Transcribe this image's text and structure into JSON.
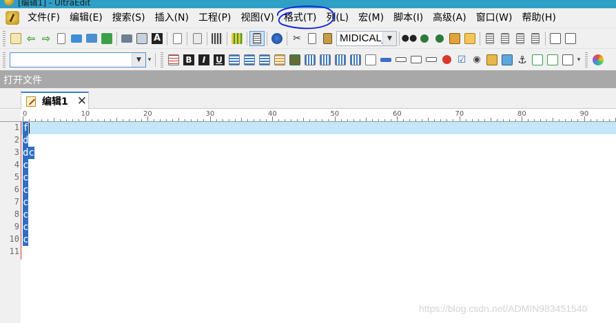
{
  "window": {
    "title": "[编辑1] - UltraEdit"
  },
  "menu": {
    "items": [
      "文件(F)",
      "编辑(E)",
      "搜索(S)",
      "插入(N)",
      "工程(P)",
      "视图(V)",
      "格式(T)",
      "列(L)",
      "宏(M)",
      "脚本(I)",
      "高级(A)",
      "窗口(W)",
      "帮助(H)"
    ]
  },
  "toolbar1": {
    "font_value": "MIDICAL_",
    "icons": [
      "new-file-icon",
      "back-arrow-icon",
      "forward-arrow-icon",
      "blank-page-icon",
      "open-folder-icon",
      "save-icon",
      "save-all-icon",
      "print-icon",
      "print-preview-icon",
      "font-a-icon",
      "document-icon",
      "properties-icon",
      "calculator-icon",
      "column-icon",
      "text-view-icon",
      "globe-icon",
      "cut-icon",
      "copy-icon",
      "paste-icon"
    ],
    "icons_right": [
      "binoculars-icon",
      "find-prev-icon",
      "find-next-icon",
      "replace-icon",
      "find-files-icon",
      "align-left-icon",
      "align-center-icon",
      "align-right-icon",
      "justify-icon",
      "split-view-icon",
      "window-icon"
    ]
  },
  "toolbar2": {
    "search_value": "",
    "format_buttons": [
      "B",
      "I",
      "U"
    ],
    "icons": [
      "table-icon",
      "list-icon-1",
      "list-icon-2",
      "list-icon-3",
      "list-icon-4",
      "color-icon",
      "green-bars-icon",
      "grid-icon-1",
      "grid-icon-2",
      "grid-icon-3",
      "grid-icon-4",
      "grid-icon-5",
      "input-box-icon",
      "label-icon",
      "textarea-icon",
      "field-icon",
      "no-entry-icon",
      "checkbox-icon",
      "radio-icon",
      "image-icon-1",
      "image-icon-2",
      "anchor-icon",
      "link-icon",
      "check-link-icon",
      "more-icon",
      "color-wheel-icon"
    ]
  },
  "open_file_bar": {
    "label": "打开文件"
  },
  "tabs": [
    {
      "label": "编辑1",
      "active": true
    }
  ],
  "ruler": {
    "labels": [
      "0",
      "10",
      "20",
      "30",
      "40",
      "50",
      "60",
      "70",
      "80",
      "90"
    ]
  },
  "editor": {
    "line_numbers": [
      "1",
      "2",
      "3",
      "4",
      "5",
      "6",
      "7",
      "8",
      "9",
      "10",
      "11"
    ],
    "lines": [
      "f",
      "d",
      "dc",
      "c",
      "c",
      "c",
      "c",
      "c",
      "c",
      "c",
      ""
    ],
    "current_line": 1
  },
  "watermark": {
    "text": "https://blog.csdn.net/ADMIN983451540"
  },
  "colors": {
    "titlebar": "#2f9fc6",
    "current_line": "#c5e5f8",
    "selection": "#2e6fc4",
    "annotation": "#1a2ed6",
    "open_bar": "#a8a8a8"
  }
}
